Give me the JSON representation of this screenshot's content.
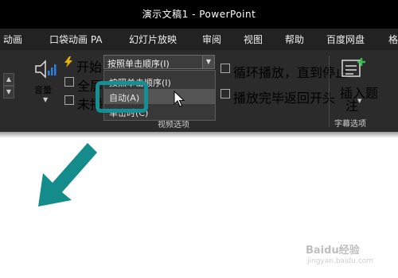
{
  "app": {
    "title": "演示文稿1  -  PowerPoint"
  },
  "tabs": [
    {
      "label": "动画"
    },
    {
      "label": "口袋动画 PA"
    },
    {
      "label": "幻灯片放映"
    },
    {
      "label": "审阅"
    },
    {
      "label": "视图"
    },
    {
      "label": "帮助"
    },
    {
      "label": "百度网盘"
    },
    {
      "label": "格"
    }
  ],
  "ribbon": {
    "volume_label": "音量",
    "start_label": "开始:",
    "start_value": "按照单击顺序(I)",
    "fullscreen_label": "全屏",
    "hide_label": "未播",
    "loop_label": "循环播放，直到停止",
    "rewind_label": "播放完毕返回开头",
    "insert_caption_label_1": "插入题",
    "insert_caption_label_2": "注",
    "caption_group_label": "字幕选项",
    "video_group_label": "视频选项"
  },
  "dropdown": {
    "options": [
      {
        "label": "按照单击顺序(I)"
      },
      {
        "label": "自动(A)"
      },
      {
        "label": "单击时(C)"
      }
    ]
  },
  "watermark": {
    "line1": "Baidu经验",
    "line2": "jingyan.baidu.com"
  },
  "colors": {
    "accent": "#149094",
    "titlebar": "#000000",
    "ribbon": "#2b2b2b"
  }
}
